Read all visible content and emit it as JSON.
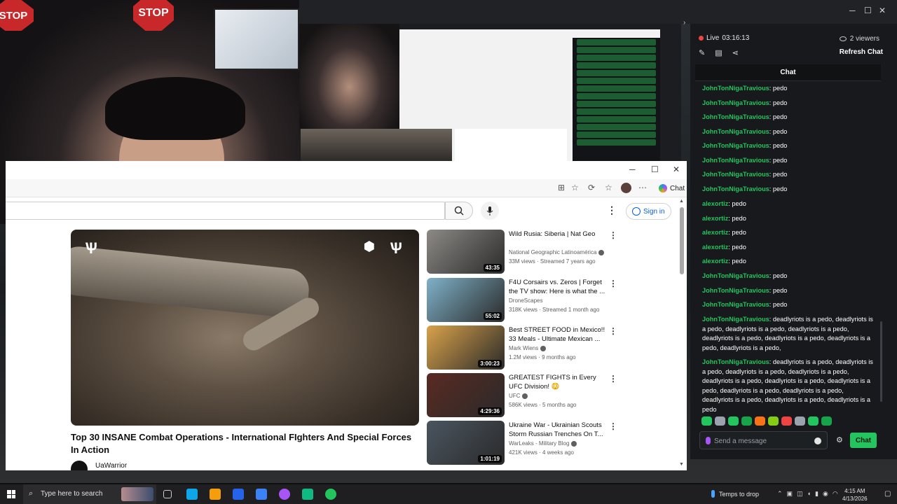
{
  "outer_window": {
    "min": "─",
    "max": "☐",
    "close": "✕"
  },
  "webcam": {
    "stop_text": "STOP"
  },
  "browser": {
    "min": "─",
    "max": "☐",
    "close": "✕",
    "copilot_label": "Chat",
    "signin_label": "Sign in"
  },
  "video": {
    "title": "Top 30 INSANE Combat Operations - International FIghters And Special Forces In Action",
    "channel": "UaWarrior"
  },
  "recommendations": [
    {
      "title": "Wild Rusia: Siberia | Nat Geo",
      "channel": "National Geographic Latinoamérica",
      "meta": "33M views · Streamed 7 years ago",
      "duration": "43:35",
      "thumb_color": "#8d8a86",
      "verified": true
    },
    {
      "title": "F4U Corsairs vs. Zeros | Forget the TV show: Here is what the ...",
      "channel": "DroneScapes",
      "meta": "318K views · Streamed 1 month ago",
      "duration": "55:02",
      "thumb_color": "#7fb1c9",
      "verified": false
    },
    {
      "title": "Best STREET FOOD in Mexico!! 33 Meals - Ultimate Mexican ...",
      "channel": "Mark Wiens",
      "meta": "1.2M views · 9 months ago",
      "duration": "3:00:23",
      "thumb_color": "#d9a24a",
      "verified": true
    },
    {
      "title": "GREATEST FIGHTS in Every UFC Division! 😳",
      "channel": "UFC",
      "meta": "586K views · 5 months ago",
      "duration": "4:29:36",
      "thumb_color": "#5a2a22",
      "verified": true
    },
    {
      "title": "Ukraine War - Ukrainian Scouts Storm Russian Trenches On T...",
      "channel": "WarLeaks - Military Blog",
      "meta": "421K views · 4 weeks ago",
      "duration": "1:01:19",
      "thumb_color": "#4a5560",
      "verified": true
    }
  ],
  "chat_panel": {
    "live_label": "Live",
    "live_time": "03:16:13",
    "viewers": "2 viewers",
    "refresh_label": "Refresh Chat",
    "header": "Chat",
    "input_placeholder": "Send a message",
    "send_label": "Chat",
    "username_color": "#22c55e",
    "messages": [
      {
        "user": "JohnTonNigaTravious",
        "text": ": pedo"
      },
      {
        "user": "JohnTonNigaTravious",
        "text": ": pedo"
      },
      {
        "user": "JohnTonNigaTravious",
        "text": ": pedo"
      },
      {
        "user": "JohnTonNigaTravious",
        "text": ": pedo"
      },
      {
        "user": "JohnTonNigaTravious",
        "text": ": pedo"
      },
      {
        "user": "JohnTonNigaTravious",
        "text": ": pedo"
      },
      {
        "user": "JohnTonNigaTravious",
        "text": ": pedo"
      },
      {
        "user": "JohnTonNigaTravious",
        "text": ": pedo"
      },
      {
        "user": "alexortiz",
        "text": ": pedo"
      },
      {
        "user": "alexortiz",
        "text": ": pedo"
      },
      {
        "user": "alexortiz",
        "text": ": pedo"
      },
      {
        "user": "alexortiz",
        "text": ": pedo"
      },
      {
        "user": "alexortiz",
        "text": ": pedo"
      },
      {
        "user": "JohnTonNigaTravious",
        "text": ": pedo"
      },
      {
        "user": "JohnTonNigaTravious",
        "text": ": pedo"
      },
      {
        "user": "JohnTonNigaTravious",
        "text": ": pedo"
      },
      {
        "user": "JohnTonNigaTravious",
        "text": ": deadlyriots is a pedo, deadlyriots is a pedo, deadlyriots is a pedo, deadlyriots is a pedo, deadlyriots is a pedo, deadlyriots is a pedo, deadlyriots is a pedo, deadlyriots is a pedo,"
      },
      {
        "user": "JohnTonNigaTravious",
        "text": ": deadlyriots is a pedo, deadlyriots is a pedo, deadlyriots is a pedo, deadlyriots is a pedo, deadlyriots is a pedo, deadlyriots is a pedo, deadlyriots is a pedo, deadlyriots is a pedo, deadlyriots is a pedo, deadlyriots is a pedo, deadlyriots is a pedo, deadlyriots is a pedo"
      }
    ],
    "emote_colors": [
      "#22c55e",
      "#9ca3af",
      "#22c55e",
      "#16a34a",
      "#f97316",
      "#84cc16",
      "#ef4444",
      "#9ca3af",
      "#22c55e",
      "#16a34a"
    ]
  },
  "taskbar": {
    "search_placeholder": "Type here to search",
    "weather": "Temps to drop",
    "time": "4:15 AM",
    "date": "4/13/2026",
    "app_colors": [
      "#3b82f6",
      "#0ea5e9",
      "#f59e0b",
      "#2563eb",
      "#3b82f6",
      "#a855f7",
      "#10b981",
      "#22c55e"
    ]
  }
}
